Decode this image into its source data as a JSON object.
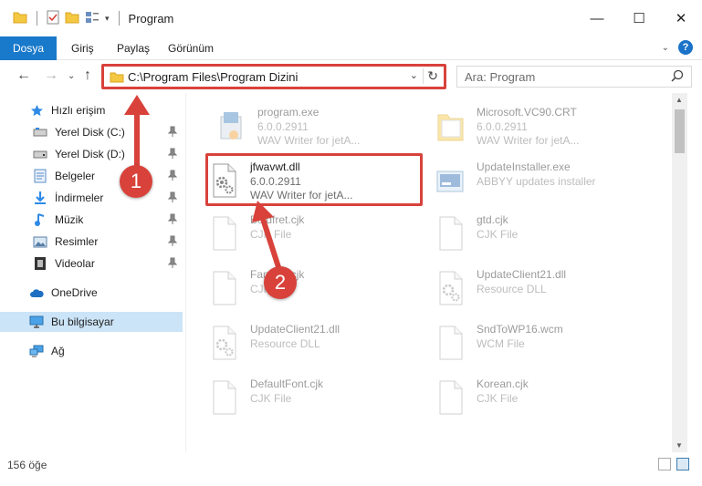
{
  "window": {
    "title": "Program",
    "controls": [
      "minimize-icon",
      "maximize-icon",
      "close-icon"
    ]
  },
  "ribbon": {
    "tabs": [
      {
        "label": "Dosya",
        "active": true
      },
      {
        "label": "Giriş",
        "active": false
      },
      {
        "label": "Paylaş",
        "active": false
      },
      {
        "label": "Görünüm",
        "active": false
      }
    ],
    "help": "?"
  },
  "address": {
    "path": "C:\\Program Files\\Program Dizini",
    "search_placeholder": "Ara: Program"
  },
  "sidebar": {
    "items": [
      {
        "label": "Hızlı erişim",
        "icon": "star-icon",
        "pinned": false
      },
      {
        "label": "Yerel Disk (C:)",
        "icon": "drive-icon",
        "pinned": true
      },
      {
        "label": "Yerel Disk (D:)",
        "icon": "drive-icon",
        "pinned": true
      },
      {
        "label": "Belgeler",
        "icon": "documents-icon",
        "pinned": true
      },
      {
        "label": "İndirmeler",
        "icon": "download-icon",
        "pinned": true
      },
      {
        "label": "Müzik",
        "icon": "music-icon",
        "pinned": true
      },
      {
        "label": "Resimler",
        "icon": "pictures-icon",
        "pinned": true
      },
      {
        "label": "Videolar",
        "icon": "videos-icon",
        "pinned": true
      },
      {
        "label": "OneDrive",
        "icon": "cloud-icon",
        "pinned": false
      },
      {
        "label": "Bu bilgisayar",
        "icon": "computer-icon",
        "pinned": false,
        "selected": true
      },
      {
        "label": "Ağ",
        "icon": "network-icon",
        "pinned": false
      }
    ]
  },
  "files": {
    "left": [
      {
        "name": "program.exe",
        "line2": "6.0.0.2911",
        "line3": "WAV Writer for jetA...",
        "icon": "exe-icon"
      },
      {
        "name": "jfwavwt.dll",
        "line2": "6.0.0.2911",
        "line3": "WAV Writer for jetA...",
        "icon": "dll-gear-icon"
      },
      {
        "name": "Boldfret.cjk",
        "line2": "CJK File",
        "line3": "",
        "icon": "blank-file-icon"
      },
      {
        "name": "Fanfare.cjk",
        "line2": "CJK File",
        "line3": "",
        "icon": "blank-file-icon"
      },
      {
        "name": "UpdateClient21.dll",
        "line2": "Resource DLL",
        "line3": "",
        "icon": "dll-gear-icon"
      },
      {
        "name": "DefaultFont.cjk",
        "line2": "CJK File",
        "line3": "",
        "icon": "blank-file-icon"
      }
    ],
    "right": [
      {
        "name": "Microsoft.VC90.CRT",
        "line2": "6.0.0.2911",
        "line3": "WAV Writer for jetA...",
        "icon": "folder-icon"
      },
      {
        "name": "UpdateInstaller.exe",
        "line2": "ABBYY updates installer",
        "line3": "",
        "icon": "installer-icon"
      },
      {
        "name": "gtd.cjk",
        "line2": "CJK File",
        "line3": "",
        "icon": "blank-file-icon"
      },
      {
        "name": "UpdateClient21.dll",
        "line2": "Resource DLL",
        "line3": "",
        "icon": "dll-gear-icon"
      },
      {
        "name": "SndToWP16.wcm",
        "line2": "WCM File",
        "line3": "",
        "icon": "blank-file-icon"
      },
      {
        "name": "Korean.cjk",
        "line2": "CJK File",
        "line3": "",
        "icon": "blank-file-icon"
      }
    ]
  },
  "status": {
    "item_count": "156 öğe"
  },
  "callouts": [
    "1",
    "2"
  ],
  "colors": {
    "accent": "#1979ca",
    "highlight": "#d8423b",
    "selected": "#cce4f7"
  }
}
